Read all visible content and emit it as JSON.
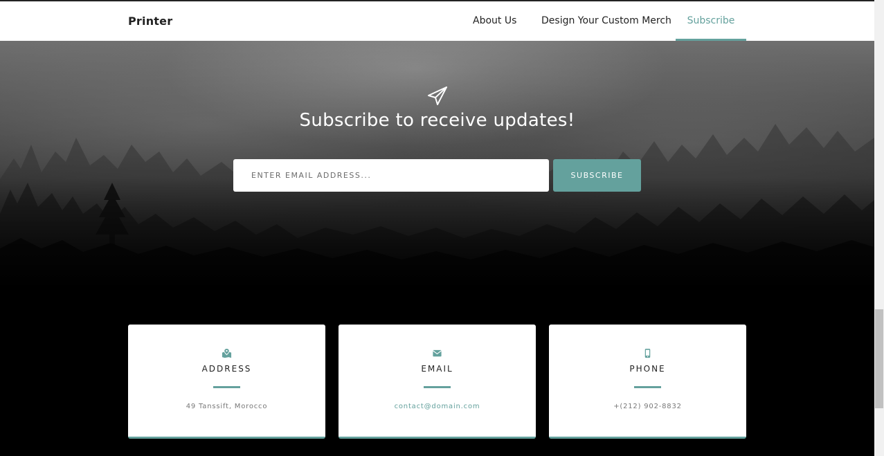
{
  "navbar": {
    "brand": "Printer",
    "links": [
      "About Us",
      "Design Your Custom Merch",
      "Subscribe"
    ],
    "active_link": "Subscribe"
  },
  "hero": {
    "icon": "paper-plane-icon",
    "title": "Subscribe to receive updates!",
    "email_placeholder": "Enter email address...",
    "email_value": "",
    "button_label": "SUBSCRIBE"
  },
  "contact": [
    {
      "icon": "map-marked-icon",
      "title": "ADDRESS",
      "value": "49 Tanssift, Morocco"
    },
    {
      "icon": "envelope-icon",
      "title": "EMAIL",
      "value": "contact@domain.com"
    },
    {
      "icon": "mobile-icon",
      "title": "PHONE",
      "value": "+(212) 902-8832"
    }
  ],
  "colors": {
    "accent": "#64a19d",
    "navbar_bg": "#ffffff",
    "page_bg": "#000000",
    "text_dark": "#222222"
  }
}
